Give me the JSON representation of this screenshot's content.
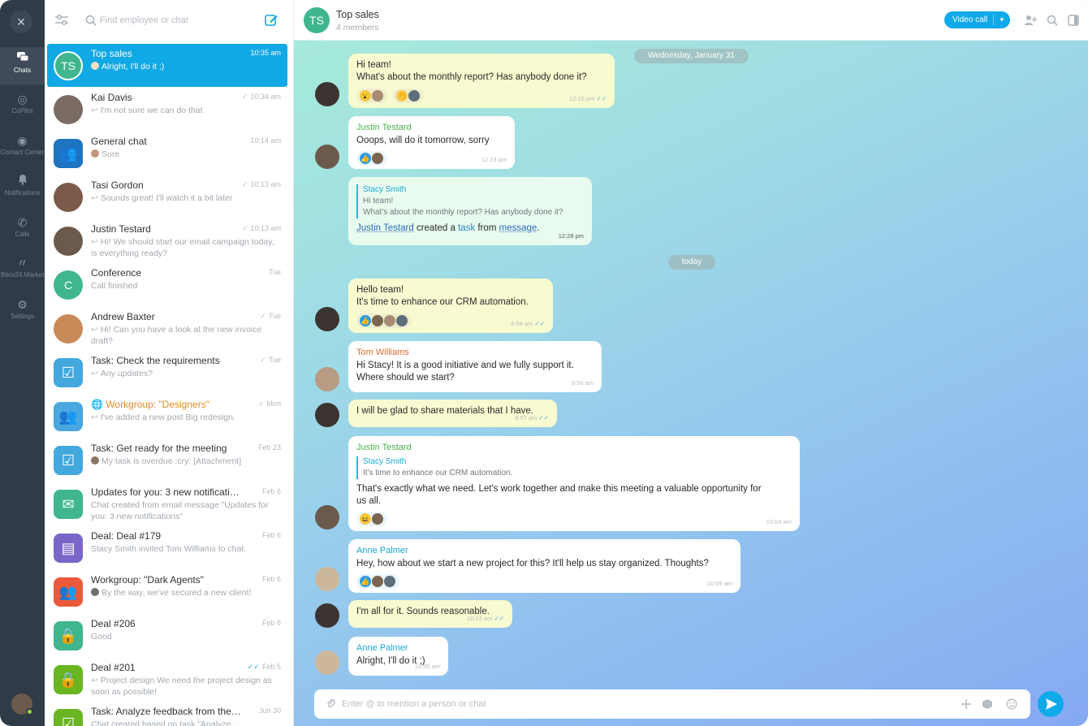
{
  "rail": {
    "items": [
      {
        "label": "Chats",
        "icon": "chat-bubbles-icon"
      },
      {
        "label": "CoPilot",
        "icon": "copilot-icon"
      },
      {
        "label": "Contact Center",
        "icon": "contact-center-icon"
      },
      {
        "label": "Notifications",
        "icon": "bell-icon"
      },
      {
        "label": "Calls",
        "icon": "phone-icon"
      },
      {
        "label": "Bitrix24.Market",
        "icon": "market-icon"
      },
      {
        "label": "Settings",
        "icon": "gear-icon"
      }
    ]
  },
  "search": {
    "placeholder": "Find employee or chat"
  },
  "chats": [
    {
      "title": "Top sales",
      "time": "10:35 am",
      "msg": "Alright, I'll do it ;)",
      "avatar_text": "TS",
      "color": "#3fb68e"
    },
    {
      "title": "Kai Davis",
      "time": "10:34 am",
      "msg": "I'm not sure we can do that",
      "color": "#7a6b64"
    },
    {
      "title": "General chat",
      "time": "10:14 am",
      "msg": "Sure",
      "color": "#1f74c1"
    },
    {
      "title": "Tasi Gordon",
      "time": "10:13 am",
      "msg": "Sounds great! I'll watch it a bit later",
      "color": "#7b5a4a"
    },
    {
      "title": "Justin Testard",
      "time": "10:13 am",
      "msg": "Hi! We should start our email campaign today, is everything ready?",
      "color": "#6b5a4c"
    },
    {
      "title": "Conference",
      "time": "Tue",
      "msg": "Call finished",
      "avatar_text": "C",
      "color": "#3fb68e"
    },
    {
      "title": "Andrew Baxter",
      "time": "Tue",
      "msg": "Hi! Can you have a look at the new invoice draft?",
      "color": "#c98a5a"
    },
    {
      "title": "Task: Check the requirements",
      "time": "Tue",
      "msg": "Any updates?",
      "color": "#42a8de"
    },
    {
      "title": "Workgroup: \"Designers\"",
      "time": "Mon",
      "msg": "I've added a new post Big redesign.",
      "color": "#4aa7e0"
    },
    {
      "title": "Task: Get ready for the meeting",
      "time": "Feb 23",
      "msg": "My task is overdue :cry: [Attachment]",
      "color": "#42a8de"
    },
    {
      "title": "Updates for you: 3 new notifications",
      "time": "Feb 6",
      "msg": "Chat created from email message \"Updates for you: 3 new notifications\"",
      "color": "#3fb68e"
    },
    {
      "title": "Deal: Deal #179",
      "time": "Feb 6",
      "msg": "Stacy Smith invited Tom Williams to chat.",
      "color": "#7b65c9"
    },
    {
      "title": "Workgroup: \"Dark Agents\"",
      "time": "Feb 6",
      "msg": "By the way, we've secured a new client!",
      "color": "#ea5a3a"
    },
    {
      "title": "Deal #206",
      "time": "Feb 6",
      "msg": "Good",
      "color": "#3fb68e"
    },
    {
      "title": "Deal #201",
      "time": "Feb 5",
      "msg": "Project design We need the project design as soon as possible!",
      "color": "#6ab522"
    },
    {
      "title": "Task: Analyze feedback from the e...",
      "time": "Jun 30",
      "msg": "Chat created based on task \"Analyze...",
      "color": "#6ab522"
    }
  ],
  "header": {
    "title": "Top sales",
    "subtitle": "4 members",
    "avatar_text": "TS",
    "video_call": "Video call"
  },
  "dates": {
    "first": "Wednesday, January 31",
    "second": "today"
  },
  "messages": [
    {
      "lines": [
        "Hi team!",
        "What's about the monthly report? Has anybody done it?"
      ],
      "time": "12:10 pm"
    },
    {
      "author": "Justin Testard",
      "text": "Ooops, will do it tomorrow, sorry",
      "time": "12:13 pm"
    },
    {
      "quote_author": "Stacy Smith",
      "quote_lines": [
        "Hi team!",
        "What's about the monthly report? Has anybody done it?"
      ],
      "actor": "Justin Testard",
      "created_a": "created a",
      "task": "task",
      "from": "from",
      "message": "message",
      "time": "12:28 pm"
    },
    {
      "lines": [
        "Hello team!",
        "It's time to enhance our CRM automation."
      ],
      "time": "9:54 am"
    },
    {
      "author": "Tom Williams",
      "lines": [
        "Hi Stacy! It is a good initiative and we fully support it.",
        "Where should we start?"
      ],
      "time": "9:56 am"
    },
    {
      "text": "I will be glad to share materials that I have.",
      "time": "9:57 am"
    },
    {
      "author": "Justin Testard",
      "quote_author": "Stacy Smith",
      "quote": "It's time to enhance our CRM automation.",
      "lines": [
        "That's exactly what we need. Let's work together and make this meeting a valuable opportunity for",
        "us all."
      ],
      "time": "10:04 am"
    },
    {
      "author": "Anne Palmer",
      "text": "Hey, how about we start a new project for this? It'll help us stay organized. Thoughts?",
      "time": "10:09 am"
    },
    {
      "text": "I'm all for it. Sounds reasonable.",
      "time": "10:13 am"
    },
    {
      "author": "Anne Palmer",
      "text": "Alright, I'll do it ;)",
      "time": "10:35 am"
    }
  ],
  "composer": {
    "placeholder": "Enter @ to mention a person or chat"
  },
  "colors": {
    "accent": "#10a9e9",
    "rail": "#2f3b47",
    "name_green": "#4bb34b",
    "name_orange": "#e06b2e",
    "name_teal": "#1ea6d8"
  }
}
